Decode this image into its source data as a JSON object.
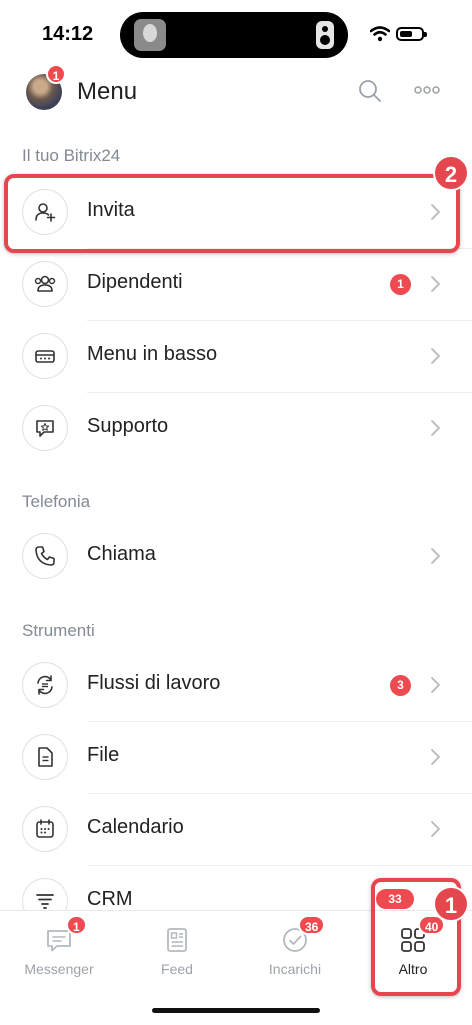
{
  "status_bar": {
    "time": "14:12"
  },
  "header": {
    "title": "Menu",
    "avatar_badge": "1"
  },
  "sections": [
    {
      "label": "Il tuo Bitrix24"
    },
    {
      "label": "Telefonia"
    },
    {
      "label": "Strumenti"
    }
  ],
  "items": [
    {
      "label": "Invita",
      "icon": "add-user-icon"
    },
    {
      "label": "Dipendenti",
      "icon": "employees-icon",
      "badge": "1"
    },
    {
      "label": "Menu in basso",
      "icon": "bottom-menu-icon"
    },
    {
      "label": "Supporto",
      "icon": "support-chat-icon"
    },
    {
      "label": "Chiama",
      "icon": "phone-icon"
    },
    {
      "label": "Flussi di lavoro",
      "icon": "workflow-icon",
      "badge": "3"
    },
    {
      "label": "File",
      "icon": "file-icon"
    },
    {
      "label": "Calendario",
      "icon": "calendar-icon"
    },
    {
      "label": "CRM",
      "icon": "crm-funnel-icon",
      "badge": "33"
    }
  ],
  "tabs": [
    {
      "label": "Messenger",
      "badge": "1",
      "icon": "messenger-icon"
    },
    {
      "label": "Feed",
      "icon": "feed-icon"
    },
    {
      "label": "Incarichi",
      "badge": "36",
      "icon": "tasks-check-icon"
    },
    {
      "label": "Altro",
      "badge": "40",
      "icon": "grid-icon",
      "active": true
    }
  ],
  "callouts": {
    "first": "1",
    "second": "2"
  },
  "colors": {
    "badge": "#ef4a50",
    "highlight": "#e5474e",
    "section_text": "#828b95",
    "tab_inactive": "#9ca3ab"
  }
}
